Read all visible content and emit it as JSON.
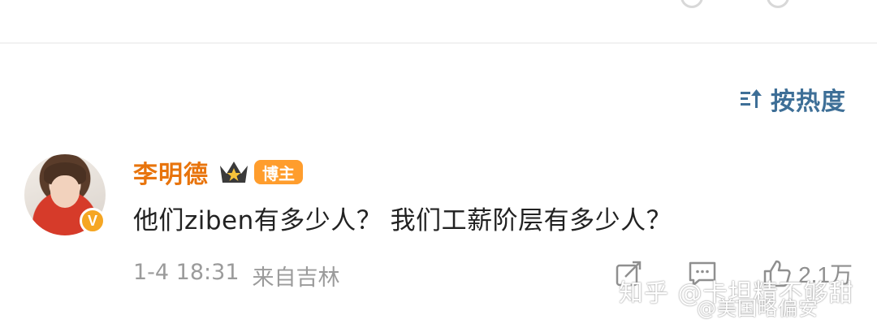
{
  "sort": {
    "label": "按热度",
    "icon": "sort-icon"
  },
  "comment": {
    "username": "李明德",
    "crown_icon": "crown-icon",
    "badge_label": "博主",
    "verified_mark": "V",
    "text": "他们ziben有多少人？ 我们工薪阶层有多少人？",
    "date": "1-4 18:31",
    "source": "来自吉林",
    "likes": "2.1万",
    "colors": {
      "username": "#e8740c",
      "badge": "#ff9d2d",
      "sort_link": "#3e6f97",
      "verified": "#f5a623"
    }
  },
  "watermarks": {
    "zhihu": "知乎 @卡坦精不够甜",
    "weibo": "@美国略偏安"
  }
}
